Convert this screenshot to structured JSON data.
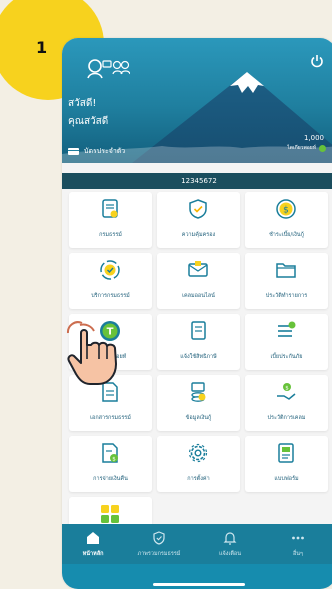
{
  "step_number": "1",
  "header": {
    "greeting": "สวัสดี!",
    "name": "คุณสวัสดี",
    "card_label": "บัตรประจำตัว",
    "points_value": "1,000",
    "points_label": "ไดเกียวพอยท์"
  },
  "policy_number": "12345672",
  "menu": [
    {
      "label": "กรมธรรม์",
      "icon": "policy-document-icon"
    },
    {
      "label": "ความคุ้มครอง",
      "icon": "shield-check-icon"
    },
    {
      "label": "ชำระเบี้ย/เงินกู้",
      "icon": "dollar-circle-icon"
    },
    {
      "label": "บริการกรมธรรม์",
      "icon": "policy-service-icon"
    },
    {
      "label": "เคลมออนไลน์",
      "icon": "online-claim-icon"
    },
    {
      "label": "ประวัติทำรายการ",
      "icon": "folder-icon"
    },
    {
      "label": "ไดเกียวพอยท์",
      "icon": "daikyo-point-icon"
    },
    {
      "label": "แจ้งใช้สิทธิภาษี",
      "icon": "tax-privilege-icon"
    },
    {
      "label": "เบี้ยประกันภัย",
      "icon": "premium-checklist-icon"
    },
    {
      "label": "เอกสารกรมธรรม์",
      "icon": "policy-file-icon"
    },
    {
      "label": "ข้อมูลเงินกู้",
      "icon": "loan-coins-icon"
    },
    {
      "label": "ประวัติการเคลม",
      "icon": "claim-history-icon"
    },
    {
      "label": "การจ่ายเงินคืน",
      "icon": "refund-document-icon"
    },
    {
      "label": "การตั้งค่า",
      "icon": "settings-gear-icon"
    },
    {
      "label": "แบบฟอร์ม",
      "icon": "form-document-icon"
    },
    {
      "label": "",
      "icon": "more-apps-icon"
    }
  ],
  "nav": [
    {
      "label": "หน้าหลัก",
      "icon": "home-icon",
      "active": true
    },
    {
      "label": "ภาพรวมกรมธรรม์",
      "icon": "shield-icon",
      "active": false
    },
    {
      "label": "แจ้งเตือน",
      "icon": "bell-icon",
      "active": false
    },
    {
      "label": "อื่นๆ",
      "icon": "more-dots-icon",
      "active": false
    }
  ],
  "colors": {
    "primary": "#1a7e9b",
    "policy_bar": "#1b4e5e",
    "accent_green": "#67c23a",
    "accent_yellow": "#f7d21e",
    "label_blue": "#1f5f7a"
  }
}
